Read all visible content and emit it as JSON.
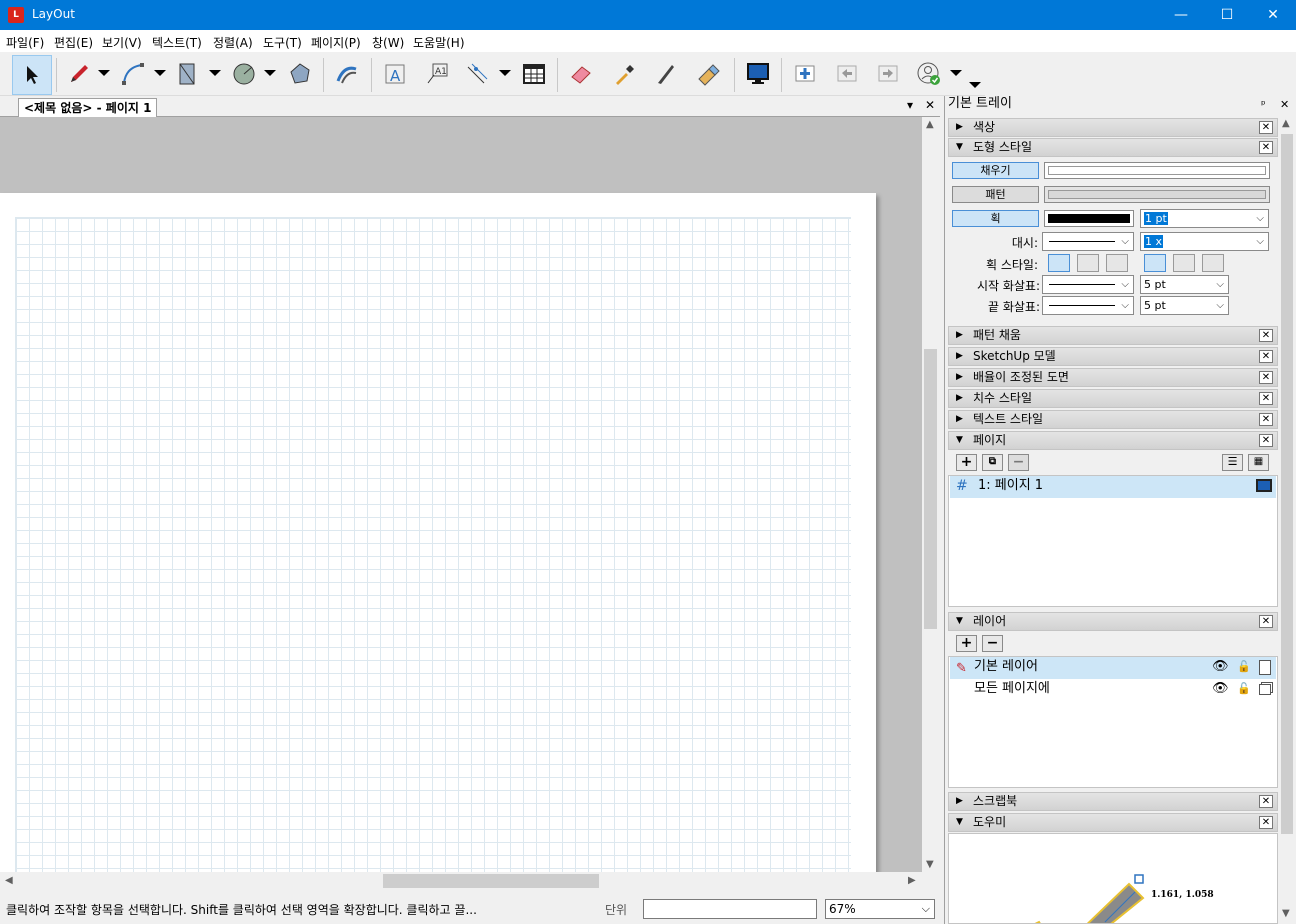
{
  "window": {
    "title": "LayOut",
    "app_icon": "layout-app-icon",
    "minimize": "—",
    "maximize": "☐",
    "close": "✕"
  },
  "menu": [
    "파일(F)",
    "편집(E)",
    "보기(V)",
    "텍스트(T)",
    "정렬(A)",
    "도구(T)",
    "페이지(P)",
    "창(W)",
    "도움말(H)"
  ],
  "toolbar": {
    "tools": [
      "select-tool",
      "pencil-tool",
      "arc-tool",
      "rectangle-tool",
      "circle-tool",
      "polygon-tool",
      "offset-tool",
      "text-tool",
      "label-tool",
      "dimension-tool",
      "table-tool",
      "eraser-tool",
      "eyedropper-tool",
      "split-tool",
      "join-tool",
      "presentation-tool",
      "add-page-tool",
      "previous-page-tool",
      "next-page-tool",
      "account-tool"
    ]
  },
  "document": {
    "tab_title": "<제목 없음> - 페이지 1",
    "tab_menu": "▾",
    "tab_close": "✕"
  },
  "status": {
    "message": "클릭하여 조작할 항목을 선택합니다. Shift를 클릭하여 선택 영역을 확장합니다. 클릭하고 끌...",
    "unit_label": "단위",
    "unit_value": "",
    "zoom": "67%"
  },
  "tray": {
    "title": "기본 트레이",
    "pin": "ᵖ",
    "close": "✕",
    "panels": {
      "color": "색상",
      "shape_style": "도형 스타일",
      "pattern_fill": "패턴 채움",
      "sketchup_model": "SketchUp 모델",
      "scaled_drawing": "배율이 조정된 도면",
      "dimension_style": "치수 스타일",
      "text_style": "텍스트 스타일",
      "pages": "페이지",
      "layers": "레이어",
      "scrapbooks": "스크랩북",
      "instructor": "도우미"
    },
    "shape_style": {
      "fill_label": "채우기",
      "pattern_label": "패턴",
      "stroke_label": "획",
      "stroke_width": "1 pt",
      "dash_label": "대시:",
      "dash_scale": "1 x",
      "stroke_style_label": "획 스타일:",
      "start_arrow_label": "시작 화살표:",
      "start_arrow_size": "5 pt",
      "end_arrow_label": "끝 화살표:",
      "end_arrow_size": "5 pt",
      "stroke_color": "#000000",
      "selected_color": "#cce4f7"
    },
    "pages": {
      "items": [
        {
          "hash": "#",
          "label": "1: 페이지 1"
        }
      ]
    },
    "layers": {
      "items": [
        {
          "label": "기본 레이어"
        },
        {
          "label": "모든 페이지에"
        }
      ]
    },
    "instructor": {
      "coords": "1.161, 1.058"
    }
  }
}
